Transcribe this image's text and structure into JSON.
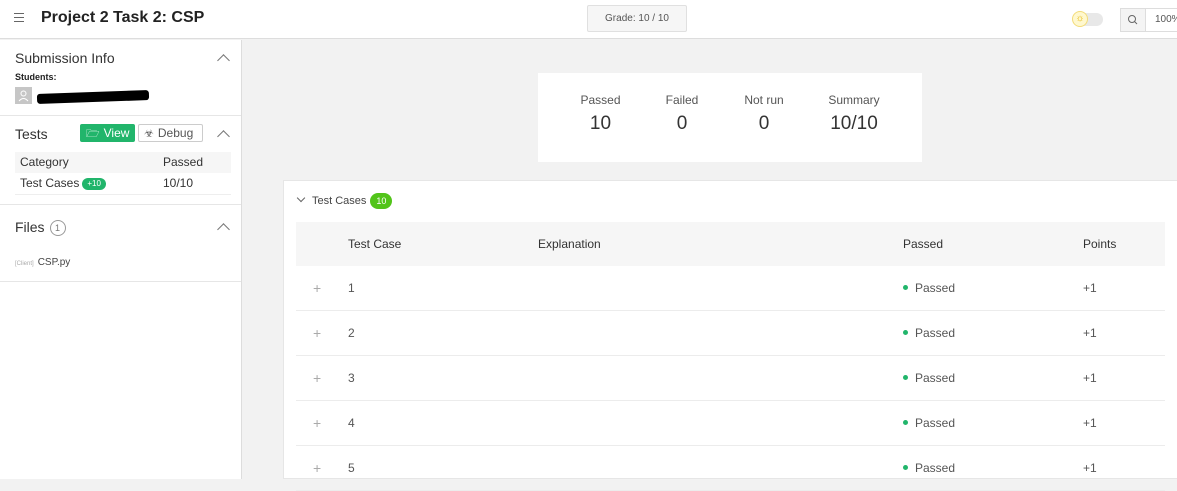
{
  "header": {
    "title": "Project 2 Task 2: CSP",
    "grade": "Grade: 10 / 10",
    "zoom": "100%",
    "icons": {
      "menu": "menu-icon",
      "theme": "sun-icon",
      "zoom": "zoom-icon"
    }
  },
  "sidebar": {
    "submission": {
      "title": "Submission Info",
      "students_label": "Students:"
    },
    "tests": {
      "title": "Tests",
      "view_label": "View",
      "debug_label": "Debug",
      "columns": [
        "Category",
        "Passed"
      ],
      "rows": [
        {
          "category": "Test Cases",
          "badge": "+10",
          "passed": "10/10"
        }
      ]
    },
    "files": {
      "title": "Files",
      "count": "1",
      "items": [
        {
          "tag": "[Client]",
          "name": "CSP.py"
        }
      ]
    }
  },
  "summary": {
    "passed_label": "Passed",
    "passed": "10",
    "failed_label": "Failed",
    "failed": "0",
    "notrun_label": "Not run",
    "notrun": "0",
    "summary_label": "Summary",
    "summary": "10/10"
  },
  "testcases": {
    "title": "Test Cases",
    "count": "10",
    "columns": {
      "case": "Test Case",
      "explanation": "Explanation",
      "passed": "Passed",
      "points": "Points"
    },
    "rows": [
      {
        "id": "1",
        "status": "Passed",
        "points": "+1"
      },
      {
        "id": "2",
        "status": "Passed",
        "points": "+1"
      },
      {
        "id": "3",
        "status": "Passed",
        "points": "+1"
      },
      {
        "id": "4",
        "status": "Passed",
        "points": "+1"
      },
      {
        "id": "5",
        "status": "Passed",
        "points": "+1"
      }
    ]
  },
  "colors": {
    "accent_green": "#21b56b",
    "badge_green": "#52c41a"
  }
}
